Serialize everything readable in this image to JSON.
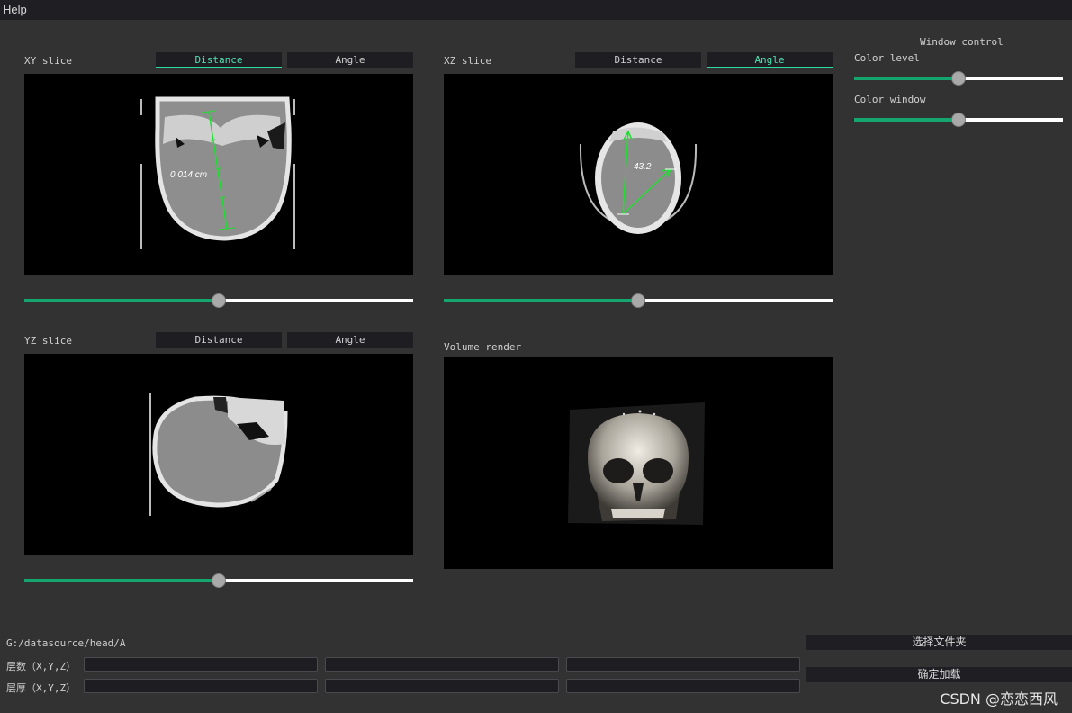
{
  "menu": {
    "help": "Help"
  },
  "xy": {
    "title": "XY slice",
    "distance": "Distance",
    "angle": "Angle",
    "measurement": "0.014  cm",
    "slider_value": 0.5
  },
  "xz": {
    "title": "XZ slice",
    "distance": "Distance",
    "angle": "Angle",
    "measurement": "43.2",
    "slider_value": 0.5
  },
  "yz": {
    "title": "YZ slice",
    "distance": "Distance",
    "angle": "Angle",
    "slider_value": 0.5
  },
  "volume": {
    "title": "Volume render"
  },
  "window_control": {
    "title": "Window control",
    "color_level_label": "Color level",
    "color_level_value": 0.5,
    "color_window_label": "Color window",
    "color_window_value": 0.5
  },
  "footer": {
    "path": "G:/datasource/head/A",
    "layers_label": "层数（X,Y,Z）",
    "thickness_label": "层厚（X,Y,Z）",
    "layers": [
      "",
      "",
      ""
    ],
    "thickness": [
      "",
      "",
      ""
    ],
    "select_folder": "选择文件夹",
    "confirm_load": "确定加载"
  },
  "watermark": "CSDN @恋恋西风",
  "colors": {
    "accent": "#15a56e",
    "active_text": "#4be2b0",
    "measure_line": "#22dd33"
  }
}
